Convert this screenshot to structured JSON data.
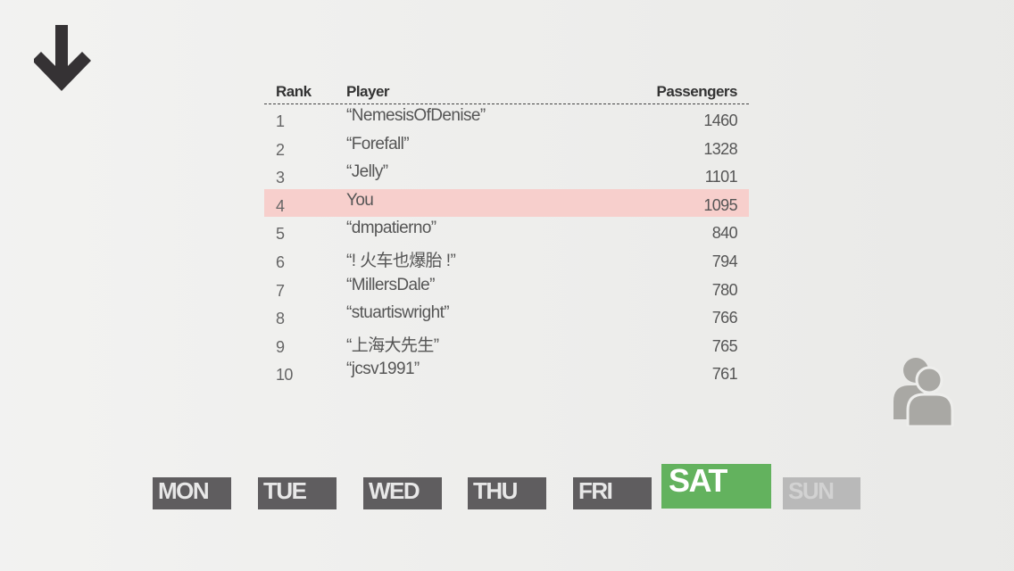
{
  "nav": {
    "back_icon": "down-arrow-icon"
  },
  "leaderboard": {
    "headers": {
      "rank": "Rank",
      "player": "Player",
      "passengers": "Passengers"
    },
    "rows": [
      {
        "rank": "1",
        "player": "“NemesisOfDenise”",
        "passengers": "1460",
        "highlight": false
      },
      {
        "rank": "2",
        "player": "“Forefall”",
        "passengers": "1328",
        "highlight": false
      },
      {
        "rank": "3",
        "player": "“Jelly”",
        "passengers": "1101",
        "highlight": false
      },
      {
        "rank": "4",
        "player": "You",
        "passengers": "1095",
        "highlight": true
      },
      {
        "rank": "5",
        "player": "“dmpatierno”",
        "passengers": "840",
        "highlight": false
      },
      {
        "rank": "6",
        "player": "“! 火车也爆胎 !”",
        "passengers": "794",
        "highlight": false
      },
      {
        "rank": "7",
        "player": "“MillersDale”",
        "passengers": "780",
        "highlight": false
      },
      {
        "rank": "8",
        "player": "“stuartiswright”",
        "passengers": "766",
        "highlight": false
      },
      {
        "rank": "9",
        "player": "“上海大先生”",
        "passengers": "765",
        "highlight": false
      },
      {
        "rank": "10",
        "player": "“jcsv1991”",
        "passengers": "761",
        "highlight": false
      }
    ]
  },
  "friends": {
    "icon": "friends-icon"
  },
  "days": [
    {
      "label": "MON",
      "state": "normal"
    },
    {
      "label": "TUE",
      "state": "normal"
    },
    {
      "label": "WED",
      "state": "normal"
    },
    {
      "label": "THU",
      "state": "normal"
    },
    {
      "label": "FRI",
      "state": "normal"
    },
    {
      "label": "SAT",
      "state": "active"
    },
    {
      "label": "SUN",
      "state": "disabled"
    }
  ],
  "colors": {
    "highlight_row": "#f7cfcc",
    "day_normal": "#5f5d5f",
    "day_active": "#63b25e",
    "day_disabled": "#b9b9b9"
  }
}
